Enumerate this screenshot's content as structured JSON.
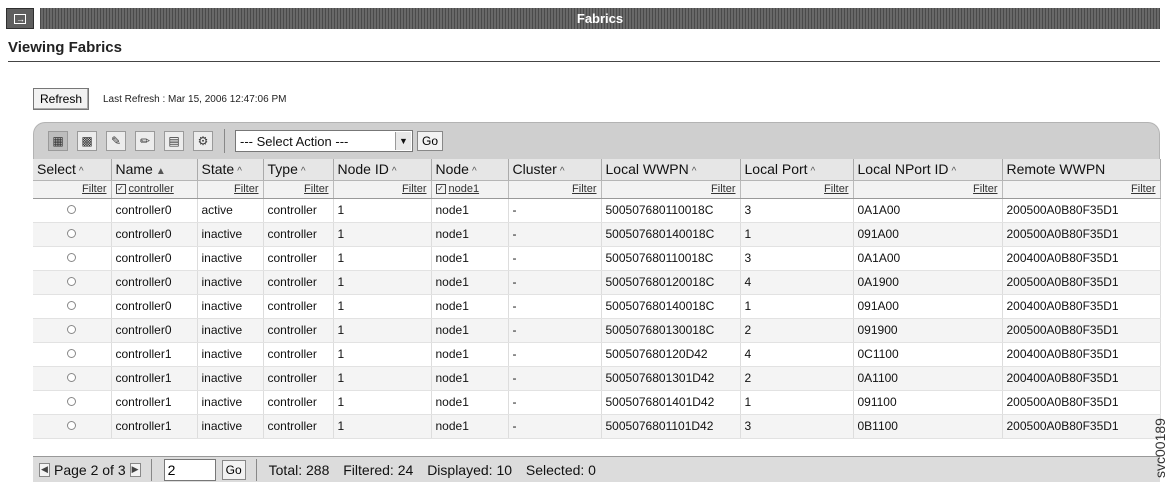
{
  "window": {
    "title": "Fabrics",
    "restore_icon": "restore-window-icon"
  },
  "page": {
    "heading": "Viewing Fabrics",
    "refresh_label": "Refresh",
    "last_refresh": "Last Refresh : Mar 15, 2006 12:47:06 PM"
  },
  "toolbar": {
    "tools": [
      "select-all-icon",
      "deselect-all-icon",
      "edit-sort-icon",
      "clear-sort-icon",
      "edit-filter-icon",
      "settings-icon"
    ],
    "action_placeholder": "--- Select Action ---",
    "go_label": "Go"
  },
  "table": {
    "columns": [
      {
        "label": "Select",
        "sort": "^"
      },
      {
        "label": "Name",
        "sort": "▲"
      },
      {
        "label": "State",
        "sort": "^"
      },
      {
        "label": "Type",
        "sort": "^"
      },
      {
        "label": "Node ID",
        "sort": "^"
      },
      {
        "label": "Node",
        "sort": "^"
      },
      {
        "label": "Cluster",
        "sort": "^"
      },
      {
        "label": "Local WWPN",
        "sort": "^"
      },
      {
        "label": "Local Port",
        "sort": "^"
      },
      {
        "label": "Local NPort ID",
        "sort": "^"
      },
      {
        "label": "Remote WWPN",
        "sort": ""
      }
    ],
    "filters": [
      "Filter",
      "controller",
      "Filter",
      "Filter",
      "Filter",
      "node1",
      "Filter",
      "Filter",
      "Filter",
      "Filter",
      "Filter"
    ],
    "rows": [
      [
        "controller0",
        "active",
        "controller",
        "1",
        "node1",
        "-",
        "500507680110018C",
        "3",
        "0A1A00",
        "200500A0B80F35D1"
      ],
      [
        "controller0",
        "inactive",
        "controller",
        "1",
        "node1",
        "-",
        "500507680140018C",
        "1",
        "091A00",
        "200500A0B80F35D1"
      ],
      [
        "controller0",
        "inactive",
        "controller",
        "1",
        "node1",
        "-",
        "500507680110018C",
        "3",
        "0A1A00",
        "200400A0B80F35D1"
      ],
      [
        "controller0",
        "inactive",
        "controller",
        "1",
        "node1",
        "-",
        "500507680120018C",
        "4",
        "0A1900",
        "200500A0B80F35D1"
      ],
      [
        "controller0",
        "inactive",
        "controller",
        "1",
        "node1",
        "-",
        "500507680140018C",
        "1",
        "091A00",
        "200400A0B80F35D1"
      ],
      [
        "controller0",
        "inactive",
        "controller",
        "1",
        "node1",
        "-",
        "500507680130018C",
        "2",
        "091900",
        "200500A0B80F35D1"
      ],
      [
        "controller1",
        "inactive",
        "controller",
        "1",
        "node1",
        "-",
        "500507680120D42",
        "4",
        "0C1100",
        "200400A0B80F35D1"
      ],
      [
        "controller1",
        "inactive",
        "controller",
        "1",
        "node1",
        "-",
        "5005076801301D42",
        "2",
        "0A1100",
        "200400A0B80F35D1"
      ],
      [
        "controller1",
        "inactive",
        "controller",
        "1",
        "node1",
        "-",
        "5005076801401D42",
        "1",
        "091100",
        "200500A0B80F35D1"
      ],
      [
        "controller1",
        "inactive",
        "controller",
        "1",
        "node1",
        "-",
        "5005076801101D42",
        "3",
        "0B1100",
        "200500A0B80F35D1"
      ]
    ]
  },
  "pager": {
    "page_text": "Page 2 of 3",
    "page_input": "2",
    "go_label": "Go",
    "total": "Total: 288",
    "filtered": "Filtered: 24",
    "displayed": "Displayed: 10",
    "selected": "Selected: 0"
  },
  "figure_id": "svc00189"
}
